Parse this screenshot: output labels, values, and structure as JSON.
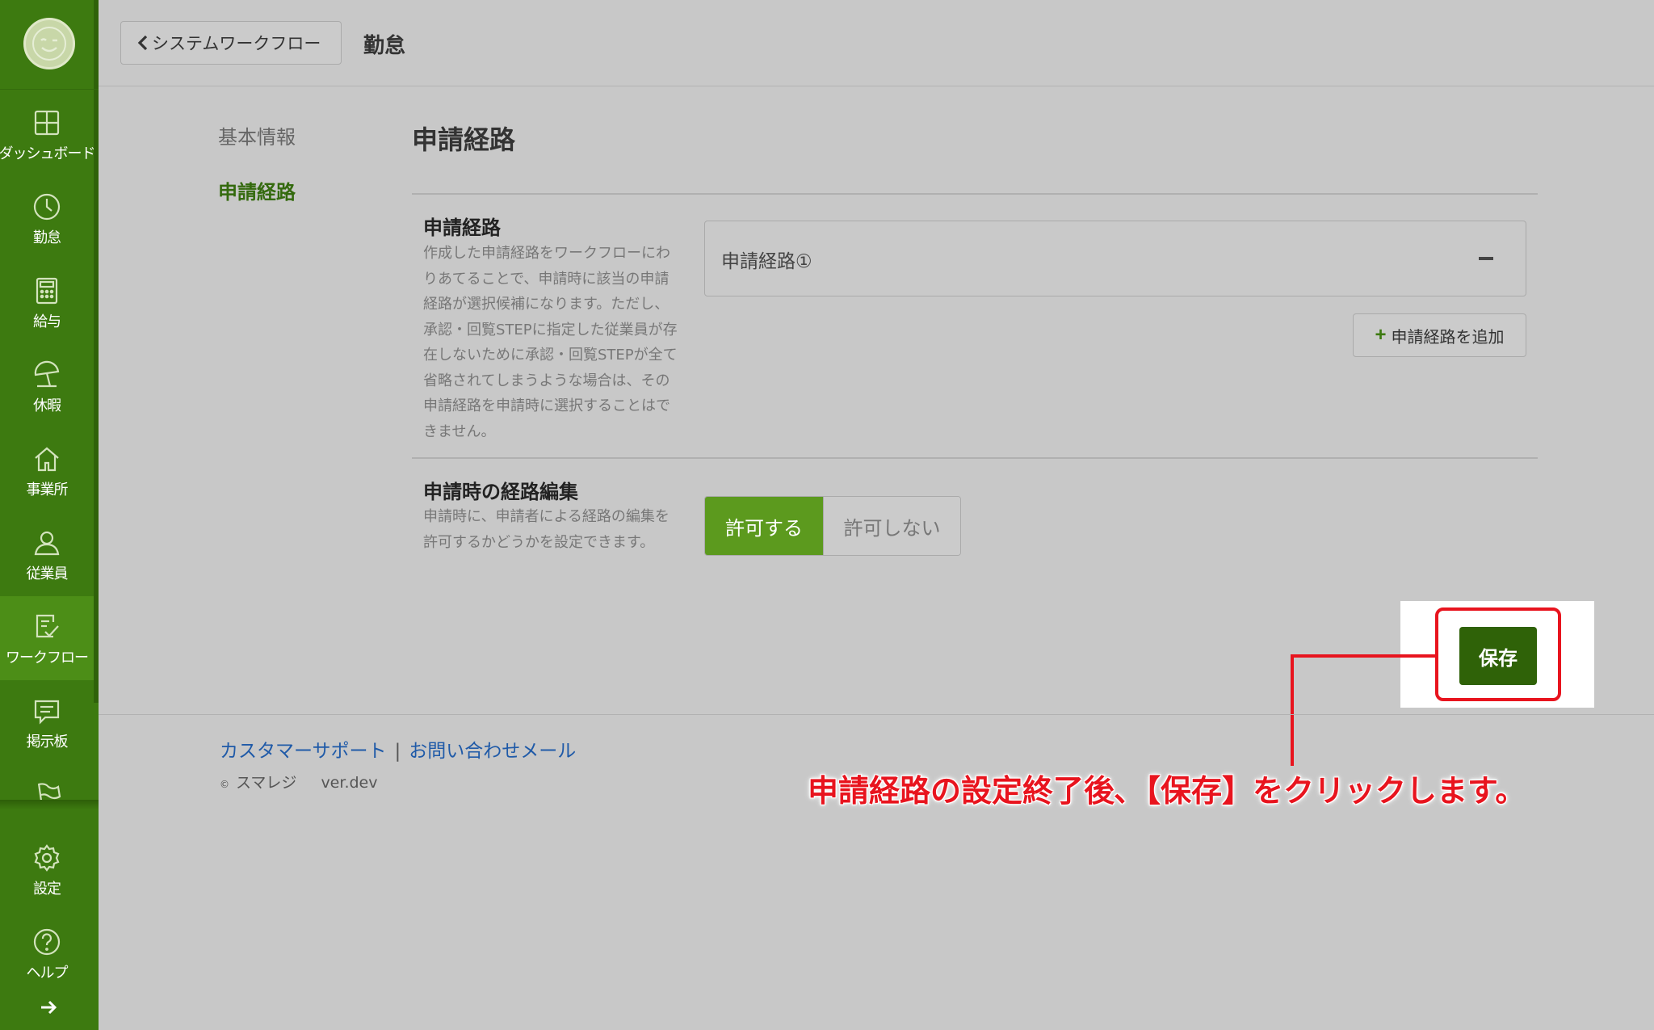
{
  "sidebar": {
    "items": [
      {
        "label": "ダッシュボード",
        "icon": "dashboard-icon"
      },
      {
        "label": "勤怠",
        "icon": "clock-icon"
      },
      {
        "label": "給与",
        "icon": "calculator-icon"
      },
      {
        "label": "休暇",
        "icon": "beach-umbrella-icon"
      },
      {
        "label": "事業所",
        "icon": "home-icon"
      },
      {
        "label": "従業員",
        "icon": "user-icon"
      },
      {
        "label": "ワークフロー",
        "icon": "checklist-icon",
        "active": true
      },
      {
        "label": "掲示板",
        "icon": "message-icon"
      },
      {
        "label": "",
        "icon": "flag-icon"
      },
      {
        "label": "設定",
        "icon": "gear-icon"
      },
      {
        "label": "ヘルプ",
        "icon": "help-icon"
      }
    ]
  },
  "header": {
    "back_label": "システムワークフロー",
    "title": "勤怠"
  },
  "subnav": {
    "items": [
      {
        "label": "基本情報"
      },
      {
        "label": "申請経路",
        "active": true
      }
    ]
  },
  "main": {
    "section_title": "申請経路",
    "route_field": {
      "title": "申請経路",
      "description": "作成した申請経路をワークフローにわりあてることで、申請時に該当の申請経路が選択候補になります。ただし、承認・回覧STEPに指定した従業員が存在しないために承認・回覧STEPが全て省略されてしまうような場合は、その申請経路を申請時に選択することはできません。",
      "routes": [
        "申請経路①"
      ],
      "add_label": "申請経路を追加"
    },
    "edit_field": {
      "title": "申請時の経路編集",
      "description": "申請時に、申請者による経路の編集を許可するかどうかを設定できます。",
      "options": [
        "許可する",
        "許可しない"
      ],
      "selected": "許可する"
    },
    "save_label": "保存"
  },
  "annotation": "申請経路の設定終了後､【保存】をクリックします。",
  "footer": {
    "support_link": "カスタマーサポート",
    "separator": "|",
    "contact_link": "お問い合わせメール",
    "copyright_symbol": "©",
    "brand": "スマレジ",
    "version": "ver.dev"
  },
  "colors": {
    "sidebar_bg": "#3d7a10",
    "accent_green": "#5c9a1e",
    "save_green": "#2f6208",
    "annotation_red": "#e8141e"
  }
}
